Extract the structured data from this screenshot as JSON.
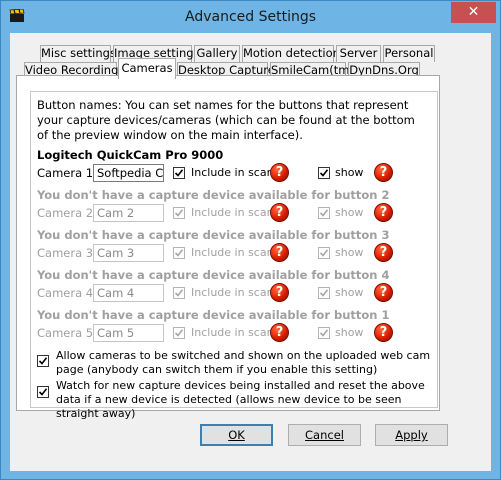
{
  "window": {
    "title": "Advanced Settings",
    "close_glyph": "✕"
  },
  "tabs_row1": [
    "Misc settings",
    "Image settings",
    "Gallery",
    "Motion detection",
    "Server",
    "Personal"
  ],
  "tabs_row2": [
    "Video Recording",
    "Cameras",
    "Desktop Capture",
    "SmileCam(tm)",
    "DynDns.Org"
  ],
  "active_tab": "Cameras",
  "panel": {
    "description": "Button names: You can set names for the buttons that represent your capture devices/cameras (which can be found at the bottom of the preview window on the main interface).",
    "device_name": "Logitech QuickCam Pro 9000",
    "include_label": "Include in scan",
    "show_label": "show",
    "help_glyph": "?",
    "cameras": [
      {
        "label": "Camera 1",
        "value": "Softpedia Cam",
        "include": true,
        "show": true
      },
      {
        "label": "Camera 2",
        "value": "Cam 2",
        "include": true,
        "show": true
      },
      {
        "label": "Camera 3",
        "value": "Cam 3",
        "include": true,
        "show": true
      },
      {
        "label": "Camera 4",
        "value": "Cam 4",
        "include": true,
        "show": true
      },
      {
        "label": "Camera 5",
        "value": "Cam 5",
        "include": true,
        "show": true
      }
    ],
    "no_device_messages": [
      "You don't have a capture device available for button 2",
      "You don't have a capture device available for button 3",
      "You don't have a capture device available for button 4",
      "You don't have a capture device available for button 1"
    ],
    "option_switch": "Allow cameras to be switched and shown on the uploaded web cam page (anybody can switch them if you enable this setting)",
    "option_watch": "Watch for new capture devices being installed and reset the above data if a new device is detected (allows new device to be seen straight away)",
    "option_switch_checked": true,
    "option_watch_checked": true
  },
  "buttons": {
    "ok": "OK",
    "cancel": "Cancel",
    "apply": "Apply"
  },
  "icons": {
    "app": "film-clapper-icon",
    "help": "help-icon",
    "close": "close-icon"
  }
}
